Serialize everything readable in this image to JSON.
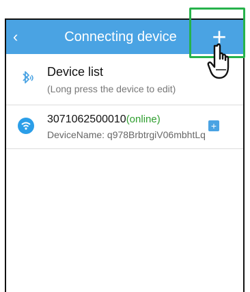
{
  "header": {
    "back_icon": "chevron-left-icon",
    "title": "Connecting device",
    "add_icon": "plus-icon"
  },
  "device_list": {
    "title": "Device list",
    "subtitle": "(Long press the device to edit)",
    "icon": "bluetooth-icon"
  },
  "devices": [
    {
      "id": "3071062500010",
      "status": "(online)",
      "name": "DeviceName: q978BrbtrgiV06mbhtLq",
      "icon": "wifi-icon",
      "action_icon": "plus-icon"
    }
  ],
  "colors": {
    "header": "#4aa3e3",
    "online": "#2e9e2e",
    "highlight": "#26b24b"
  }
}
